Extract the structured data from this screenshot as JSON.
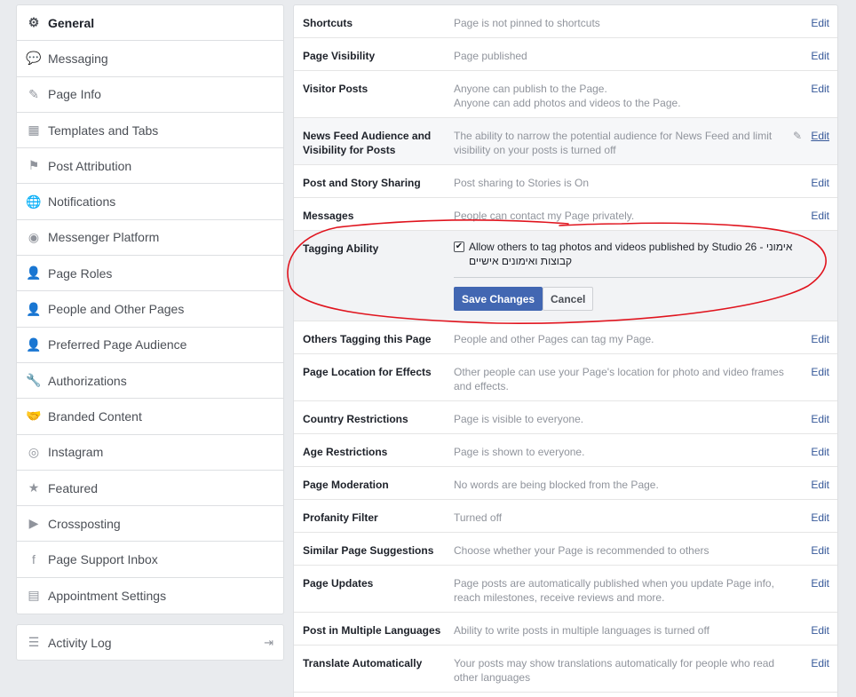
{
  "sidebar": {
    "items": [
      {
        "label": "General",
        "icon": "gear-icon",
        "glyph": "⚙"
      },
      {
        "label": "Messaging",
        "icon": "messages-icon",
        "glyph": "💬"
      },
      {
        "label": "Page Info",
        "icon": "pencil-icon",
        "glyph": "✎"
      },
      {
        "label": "Templates and Tabs",
        "icon": "grid-icon",
        "glyph": "▦"
      },
      {
        "label": "Post Attribution",
        "icon": "flag-icon",
        "glyph": "⚑"
      },
      {
        "label": "Notifications",
        "icon": "globe-icon",
        "glyph": "🌐"
      },
      {
        "label": "Messenger Platform",
        "icon": "messenger-icon",
        "glyph": "◉"
      },
      {
        "label": "Page Roles",
        "icon": "person-icon",
        "glyph": "👤"
      },
      {
        "label": "People and Other Pages",
        "icon": "person-star-icon",
        "glyph": "👤"
      },
      {
        "label": "Preferred Page Audience",
        "icon": "person-star-icon",
        "glyph": "👤"
      },
      {
        "label": "Authorizations",
        "icon": "wrench-icon",
        "glyph": "🔧"
      },
      {
        "label": "Branded Content",
        "icon": "handshake-icon",
        "glyph": "🤝"
      },
      {
        "label": "Instagram",
        "icon": "instagram-icon",
        "glyph": "◎"
      },
      {
        "label": "Featured",
        "icon": "star-icon",
        "glyph": "★"
      },
      {
        "label": "Crossposting",
        "icon": "video-camera-icon",
        "glyph": "▶"
      },
      {
        "label": "Page Support Inbox",
        "icon": "facebook-icon",
        "glyph": "f"
      },
      {
        "label": "Appointment Settings",
        "icon": "calendar-icon",
        "glyph": "▤"
      }
    ],
    "activity_log": {
      "label": "Activity Log",
      "icon": "list-icon",
      "glyph": "☰",
      "export_glyph": "⇥"
    }
  },
  "settings": {
    "edit_label": "Edit",
    "rows": [
      {
        "label": "Shortcuts",
        "value": "Page is not pinned to shortcuts"
      },
      {
        "label": "Page Visibility",
        "value": "Page published"
      },
      {
        "label": "Visitor Posts",
        "value": "Anyone can publish to the Page.\nAnyone can add photos and videos to the Page."
      },
      {
        "label": "News Feed Audience and Visibility for Posts",
        "value": "The ability to narrow the potential audience for News Feed and limit visibility on your posts is turned off"
      },
      {
        "label": "Post and Story Sharing",
        "value": "Post sharing to Stories is On"
      },
      {
        "label": "Messages",
        "value": "People can contact my Page privately."
      },
      {
        "label": "Tagging Ability",
        "checkbox_label": "Allow others to tag photos and videos published by Studio 26 - אימוני קבוצות ואימונים אישיים",
        "checked": true,
        "save_label": "Save Changes",
        "cancel_label": "Cancel"
      },
      {
        "label": "Others Tagging this Page",
        "value": "People and other Pages can tag my Page."
      },
      {
        "label": "Page Location for Effects",
        "value": "Other people can use your Page's location for photo and video frames and effects."
      },
      {
        "label": "Country Restrictions",
        "value": "Page is visible to everyone."
      },
      {
        "label": "Age Restrictions",
        "value": "Page is shown to everyone."
      },
      {
        "label": "Page Moderation",
        "value": "No words are being blocked from the Page."
      },
      {
        "label": "Profanity Filter",
        "value": "Turned off"
      },
      {
        "label": "Similar Page Suggestions",
        "value": "Choose whether your Page is recommended to others"
      },
      {
        "label": "Page Updates",
        "value": "Page posts are automatically published when you update Page info, reach milestones, receive reviews and more."
      },
      {
        "label": "Post in Multiple Languages",
        "value": "Ability to write posts in multiple languages is turned off"
      },
      {
        "label": "Translate Automatically",
        "value": "Your posts may show translations automatically for people who read other languages"
      }
    ]
  },
  "colors": {
    "link": "#365899",
    "primary_button": "#4267b2",
    "annotation": "#e0141e"
  }
}
